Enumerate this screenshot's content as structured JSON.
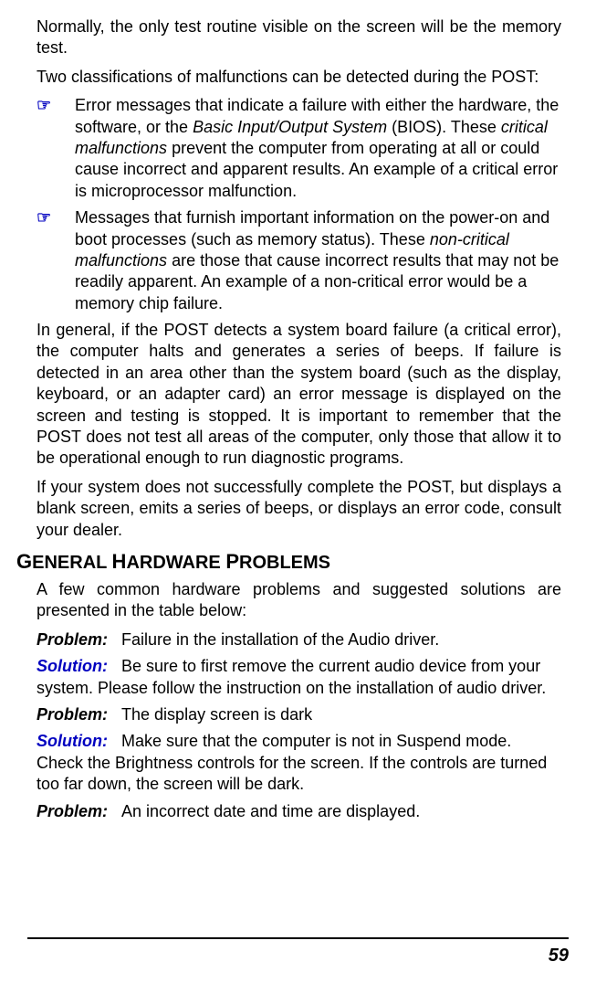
{
  "intro": {
    "p1": "Normally, the only test routine visible on the screen will be the memory test.",
    "p2": "Two classifications of malfunctions can be detected during the POST:"
  },
  "bulletGlyph": "☞",
  "bullets": [
    {
      "t1": "Error messages that indicate a failure with either the hardware, the software, or the ",
      "i1": "Basic Input/Output System",
      "t2": " (BIOS). These ",
      "i2": "critical malfunctions",
      "t3": " prevent the computer from operating at all or could cause incorrect and apparent results. An example of a critical error is microprocessor malfunction."
    },
    {
      "t1": "Messages that furnish important information on the power-on and boot processes (such as memory status). These ",
      "i1": "non-critical malfunctions",
      "t2": " are those that cause incorrect results that may not be readily apparent. An example of a non-critical error would be a memory chip failure.",
      "i2": "",
      "t3": ""
    }
  ],
  "after": {
    "p1": "In general, if the POST detects a system board failure (a critical error), the computer halts and generates a series of beeps. If failure is detected in an area other than the system board (such as the display, keyboard, or an adapter card) an error message is displayed on the screen and testing is stopped. It is important to remember that the POST does not test all areas of the computer, only those that allow it to be operational enough to run diagnostic programs.",
    "p2": "If your system does not successfully complete the POST, but displays a blank screen, emits a series of beeps, or displays an error code, consult your dealer."
  },
  "heading": "GENERAL HARDWARE PROBLEMS",
  "ghIntro": "A few common hardware problems and suggested solutions are presented in the table below:",
  "labels": {
    "problem": "Problem:",
    "solution": "Solution:"
  },
  "items": [
    {
      "problem": "Failure in the installation of the Audio driver.",
      "solution": "Be sure to first remove the current audio device from your system. Please follow the instruction on the installation of audio driver."
    },
    {
      "problem": "The display screen is dark",
      "solution": "Make sure that the computer is not in Suspend mode. Check the Brightness controls for the screen.  If the controls are turned too far down, the screen will be dark."
    },
    {
      "problem": "An incorrect date and time are displayed.",
      "solution": ""
    }
  ],
  "pageNumber": "59"
}
